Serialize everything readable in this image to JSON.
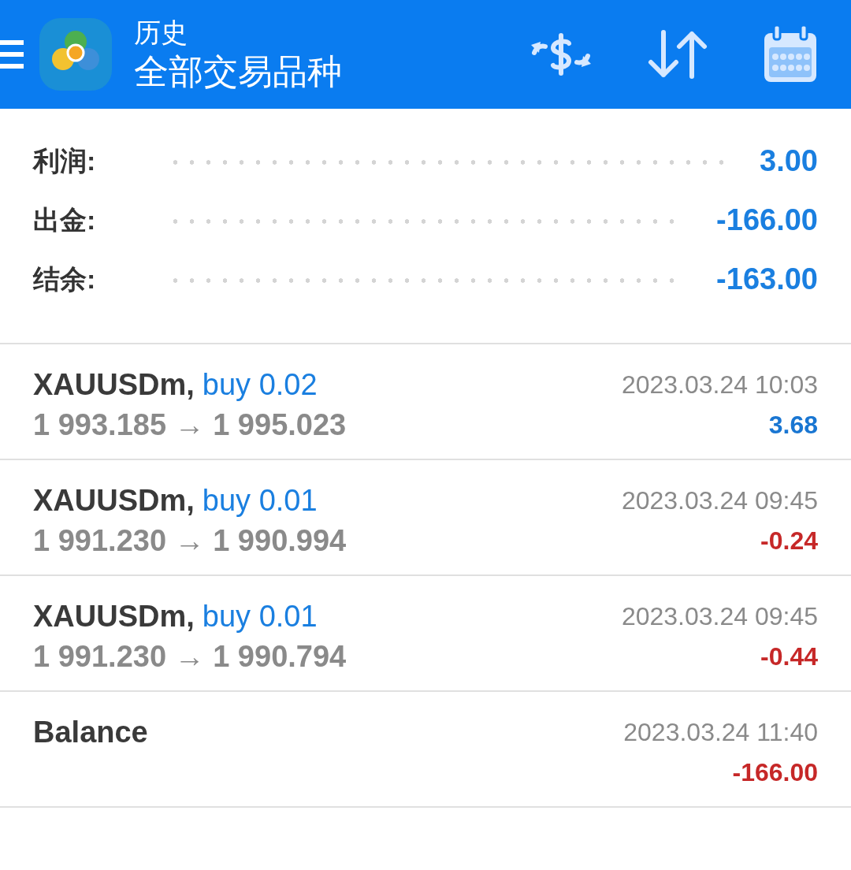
{
  "header": {
    "title": "历史",
    "subtitle": "全部交易品种"
  },
  "summary": [
    {
      "label": "利润:",
      "value": "3.00"
    },
    {
      "label": "出金:",
      "value": "-166.00"
    },
    {
      "label": "结余:",
      "value": "-163.00"
    }
  ],
  "deals": [
    {
      "kind": "trade",
      "symbol": "XAUUSDm,",
      "action": "buy 0.02",
      "prices": "1 993.185 → 1 995.023",
      "time": "2023.03.24 10:03",
      "profit": "3.68",
      "color": "#1976d2"
    },
    {
      "kind": "trade",
      "symbol": "XAUUSDm,",
      "action": "buy 0.01",
      "prices": "1 991.230 → 1 990.994",
      "time": "2023.03.24 09:45",
      "profit": "-0.24",
      "color": "#c62828"
    },
    {
      "kind": "trade",
      "symbol": "XAUUSDm,",
      "action": "buy 0.01",
      "prices": "1 991.230 → 1 990.794",
      "time": "2023.03.24 09:45",
      "profit": "-0.44",
      "color": "#c62828"
    },
    {
      "kind": "balance",
      "symbol": "Balance",
      "time": "2023.03.24 11:40",
      "profit": "-166.00",
      "color": "#c62828"
    }
  ]
}
